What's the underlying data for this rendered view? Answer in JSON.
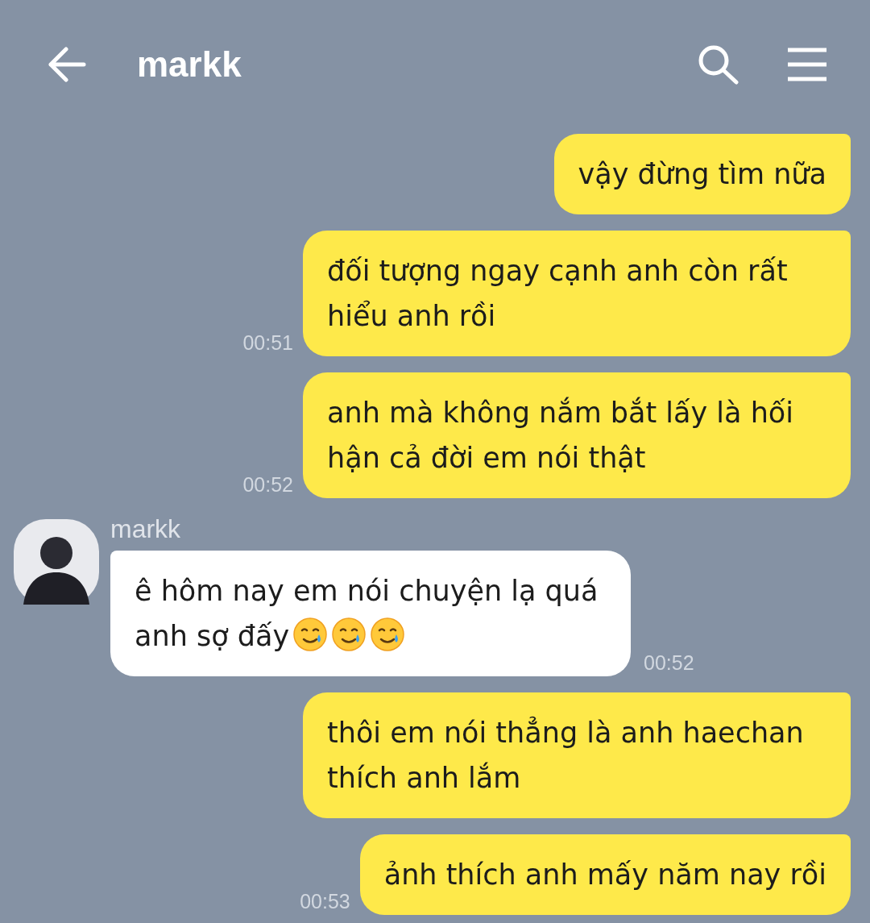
{
  "header": {
    "title": "markk"
  },
  "messages": [
    {
      "kind": "sent",
      "text": "vậy đừng tìm nữa"
    },
    {
      "kind": "sent",
      "text": "đối tượng ngay cạnh anh còn rất hiểu anh rồi",
      "time": "00:51"
    },
    {
      "kind": "sent",
      "text": "anh mà không nắm bắt lấy là hối hận cả đời em nói thật",
      "time": "00:52"
    },
    {
      "kind": "received",
      "sender": "markk",
      "text": "ê hôm nay em nói chuyện lạ quá anh sợ đấy",
      "emojis": [
        {
          "kind": "smiling-with-tear"
        },
        {
          "kind": "smiling-with-tear"
        },
        {
          "kind": "smiling-with-tear"
        }
      ],
      "time": "00:52"
    },
    {
      "kind": "sent",
      "text": "thôi em nói thẳng là anh haechan thích anh lắm"
    },
    {
      "kind": "sent",
      "text": "ảnh thích anh mấy năm nay rồi",
      "time": "00:53"
    }
  ]
}
